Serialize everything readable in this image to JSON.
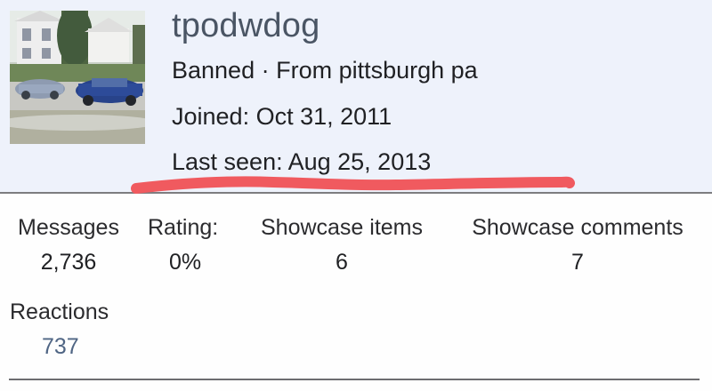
{
  "profile": {
    "username": "tpodwdog",
    "status_line": "Banned · From pittsburgh pa",
    "joined": "Joined: Oct 31, 2011",
    "last_seen": "Last seen: Aug 25, 2013"
  },
  "stats": {
    "messages": {
      "label": "Messages",
      "value": "2,736"
    },
    "rating": {
      "label": "Rating:",
      "value": "0%"
    },
    "showcase_items": {
      "label": "Showcase items",
      "value": "6"
    },
    "showcase_comments": {
      "label": "Showcase comments",
      "value": "7"
    },
    "reactions": {
      "label": "Reactions",
      "value": "737"
    }
  },
  "colors": {
    "header_bg": "#eef2fb",
    "username": "#4a5564",
    "reactions_value": "#4f6584",
    "annotation_stroke": "#f05a5f"
  },
  "icons": {
    "avatar": "user-avatar-photo"
  }
}
